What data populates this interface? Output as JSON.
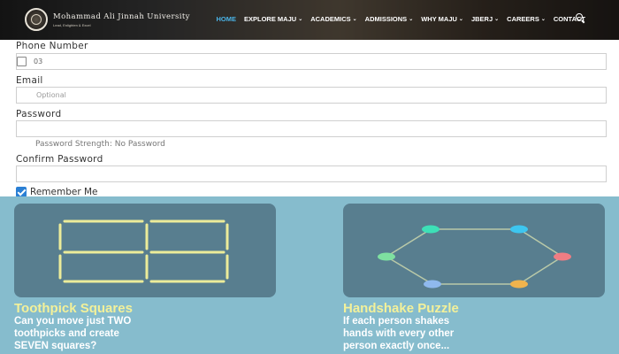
{
  "header": {
    "university_name": "Mohammad Ali Jinnah University",
    "tagline": "Lead, Enlighten & Excel",
    "nav": [
      {
        "label": "HOME",
        "active": true,
        "dropdown": false
      },
      {
        "label": "EXPLORE MAJU",
        "active": false,
        "dropdown": true
      },
      {
        "label": "ACADEMICS",
        "active": false,
        "dropdown": true
      },
      {
        "label": "ADMISSIONS",
        "active": false,
        "dropdown": true
      },
      {
        "label": "WHY MAJU",
        "active": false,
        "dropdown": true
      },
      {
        "label": "JBERJ",
        "active": false,
        "dropdown": true
      },
      {
        "label": "CAREERS",
        "active": false,
        "dropdown": true
      },
      {
        "label": "CONTACT",
        "active": false,
        "dropdown": false
      }
    ],
    "accent_color": "#4ab3e6"
  },
  "form": {
    "phone_label": "Phone Number",
    "phone_value": "03",
    "email_label": "Email",
    "email_placeholder": "Optional",
    "password_label": "Password",
    "password_strength": "Password Strength: No Password",
    "confirm_label": "Confirm Password",
    "remember_label": "Remember Me",
    "remember_checked": true
  },
  "cards": [
    {
      "title": "Toothpick Squares",
      "description": [
        "Can you move just TWO",
        "toothpicks and create",
        "SEVEN squares?"
      ]
    },
    {
      "title": "Handshake Puzzle",
      "description": [
        "If each person shakes",
        "hands with every other",
        "person exactly once..."
      ]
    }
  ],
  "colors": {
    "band": "#86bccd",
    "card": "#587e8f",
    "title": "#f3f19a",
    "checkbox": "#2a7fd4",
    "dots": [
      "#3de0b7",
      "#3dc6f0",
      "#f07d83",
      "#f0b34d",
      "#8fb9ee",
      "#7ee0a0"
    ]
  }
}
